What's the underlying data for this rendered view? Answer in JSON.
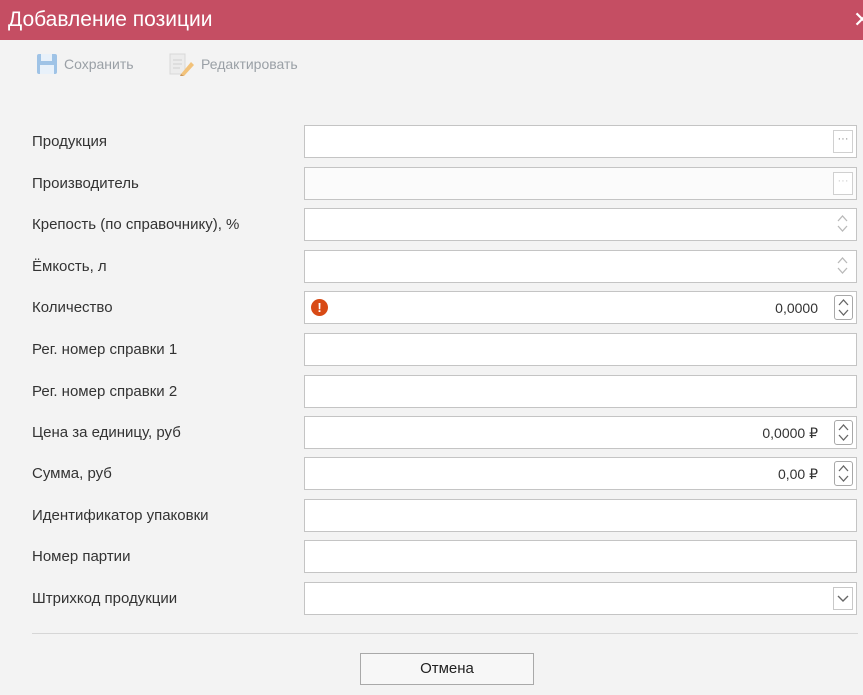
{
  "dialog": {
    "title": "Добавление позиции"
  },
  "toolbar": {
    "save_label": "Сохранить",
    "edit_label": "Редактировать"
  },
  "fields": [
    {
      "label": "Продукция",
      "value": "",
      "control": "dots"
    },
    {
      "label": "Производитель",
      "value": "",
      "control": "dots-disabled"
    },
    {
      "label": "Крепость (по справочнику), %",
      "value": "",
      "control": "spin"
    },
    {
      "label": "Ёмкость, л",
      "value": "",
      "control": "spin"
    },
    {
      "label": "Количество",
      "value": "0,0000",
      "control": "spin-boxed",
      "error": true
    },
    {
      "label": "Рег. номер справки 1",
      "value": "",
      "control": "none"
    },
    {
      "label": "Рег. номер справки 2",
      "value": "",
      "control": "none"
    },
    {
      "label": "Цена за единицу, руб",
      "value": "0,0000 ₽",
      "control": "spin-boxed"
    },
    {
      "label": "Сумма, руб",
      "value": "0,00 ₽",
      "control": "spin-boxed"
    },
    {
      "label": "Идентификатор упаковки",
      "value": "",
      "control": "none"
    },
    {
      "label": "Номер партии",
      "value": "",
      "control": "none"
    },
    {
      "label": "Штрихкод продукции",
      "value": "",
      "control": "dropdown"
    }
  ],
  "buttons": {
    "cancel_label": "Отмена"
  },
  "colors": {
    "titlebar": "#c54e63",
    "error_icon": "#d84a15",
    "toolbar_disabled": "#9aa0a6"
  }
}
